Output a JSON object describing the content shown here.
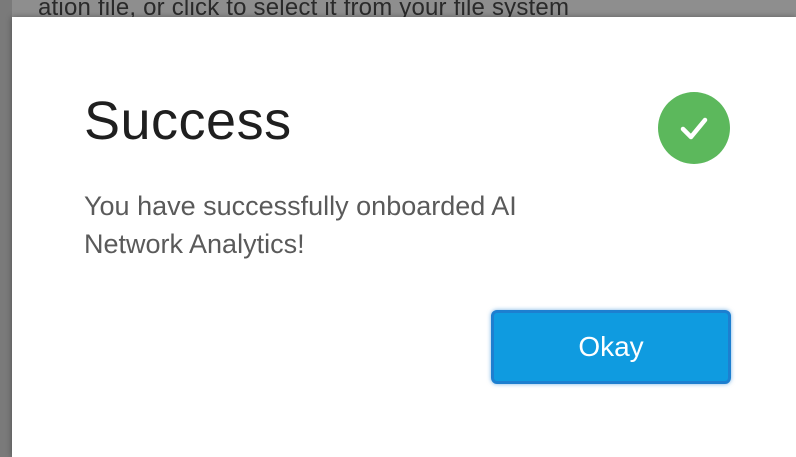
{
  "background": {
    "text": "ation file, or click to select it from your file system"
  },
  "dialog": {
    "title": "Success",
    "icon": "check-circle-icon",
    "message": "You have successfully onboarded AI Network Analytics!",
    "okay_label": "Okay"
  },
  "colors": {
    "success_green": "#5cb85c",
    "button_blue": "#0f9be0",
    "button_border": "#1d7fd0"
  }
}
